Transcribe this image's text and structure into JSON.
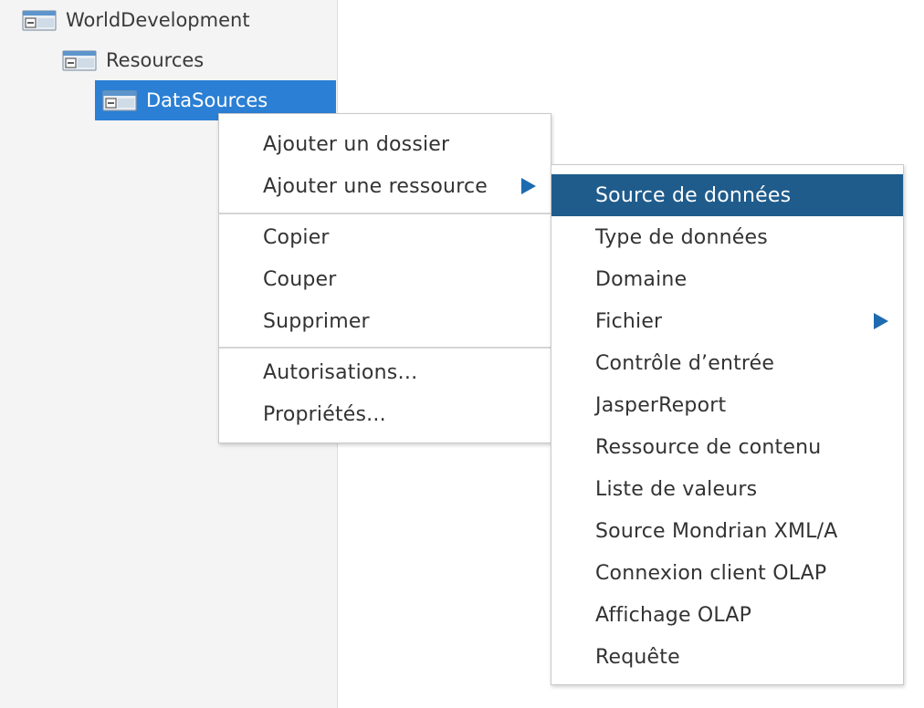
{
  "tree": {
    "nodes": [
      {
        "label": "WorldDevelopment",
        "icon": "folder-open-icon"
      },
      {
        "label": "Resources",
        "icon": "folder-open-icon"
      },
      {
        "label": "DataSources",
        "icon": "folder-open-icon",
        "selected": true
      }
    ]
  },
  "context_menu": {
    "items": [
      "Ajouter un dossier",
      "Ajouter une ressource",
      "Copier",
      "Couper",
      "Supprimer",
      "Autorisations…",
      "Propriétés..."
    ],
    "submenu_indicator_icon": "triangle-right-icon"
  },
  "submenu": {
    "items": [
      "Source de données",
      "Type de données",
      "Domaine",
      "Fichier",
      "Contrôle d’entrée",
      "JasperReport",
      "Ressource de contenu",
      "Liste de valeurs",
      "Source Mondrian XML/A",
      "Connexion client OLAP",
      "Affichage OLAP",
      "Requête"
    ],
    "highlighted_item": "Source de données"
  },
  "colors": {
    "selection": "#2b7fd4",
    "menu_highlight": "#1f5c8c",
    "arrow": "#1d6bb0"
  }
}
